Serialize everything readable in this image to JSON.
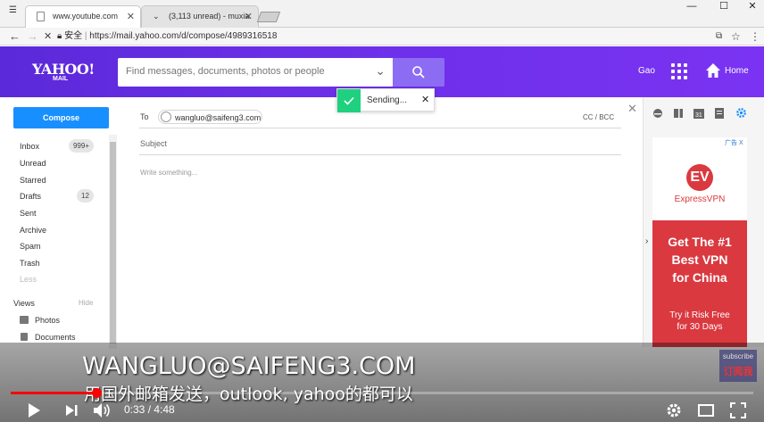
{
  "browser": {
    "tabs": [
      {
        "title": "www.youtube.com"
      },
      {
        "title": "(3,113 unread) - muxia"
      }
    ],
    "secure_label": "安全",
    "url": "https://mail.yahoo.com/d/compose/4989316518"
  },
  "header": {
    "logo": "YAHOO!",
    "logo_sub": "MAIL",
    "search_placeholder": "Find messages, documents, photos or people",
    "user_name": "Gao",
    "home_label": "Home",
    "brand_color": "#6b2fe8"
  },
  "toast": {
    "text": "Sending..."
  },
  "sidebar": {
    "compose_label": "Compose",
    "folders": [
      {
        "label": "Inbox",
        "count": "999+"
      },
      {
        "label": "Unread",
        "count": ""
      },
      {
        "label": "Starred",
        "count": ""
      },
      {
        "label": "Drafts",
        "count": "12"
      },
      {
        "label": "Sent",
        "count": ""
      },
      {
        "label": "Archive",
        "count": ""
      },
      {
        "label": "Spam",
        "count": ""
      },
      {
        "label": "Trash",
        "count": ""
      },
      {
        "label": "Less",
        "count": ""
      }
    ],
    "views_label": "Views",
    "views_hide": "Hide",
    "views": [
      {
        "label": "Photos",
        "icon": "photo-icon"
      },
      {
        "label": "Documents",
        "icon": "document-icon"
      }
    ]
  },
  "compose": {
    "to_label": "To",
    "recipient": "wangluo@saifeng3.com",
    "cc_bcc": "CC / BCC",
    "subject_placeholder": "Subject",
    "body_placeholder": "Write something..."
  },
  "ad": {
    "choice": "广告 X",
    "logo_text": "EV",
    "brand": "ExpressVPN",
    "headline_1": "Get The #1",
    "headline_2": "Best VPN",
    "headline_3": "for China",
    "cta_1": "Try it Risk Free",
    "cta_2": "for 30 Days",
    "accent": "#da3940"
  },
  "video": {
    "caption_1": "WANGLUO@SAIFENG3.COM",
    "caption_2": "用国外邮箱发送，outlook, yahoo的都可以",
    "subscribe_1": "subscribe",
    "subscribe_2": "订阅我",
    "time": "0:33 / 4:48",
    "progress": 0.115
  }
}
